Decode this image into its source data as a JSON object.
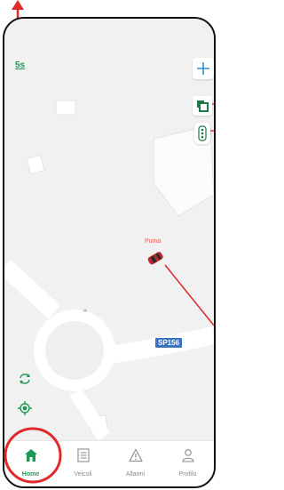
{
  "map": {
    "refresh_interval": "5s",
    "vehicle_label": "Puma",
    "road_label": "SP156"
  },
  "controls": {
    "add_icon": "plus-icon",
    "layers_icon": "layers-icon",
    "traffic_icon": "traffic-light-icon",
    "rotate_icon": "rotate-icon",
    "locate_icon": "locate-icon"
  },
  "tabs": [
    {
      "label": "Home",
      "icon": "home-icon",
      "active": true
    },
    {
      "label": "Veicoli",
      "icon": "list-icon",
      "active": false
    },
    {
      "label": "Allarmi",
      "icon": "warning-icon",
      "active": false
    },
    {
      "label": "Profilo",
      "icon": "user-icon",
      "active": false
    }
  ],
  "colors": {
    "accent": "#1c9a55",
    "vehicle": "#c0262c",
    "annotation": "#e02a2a",
    "road_badge": "#3b73c4"
  }
}
